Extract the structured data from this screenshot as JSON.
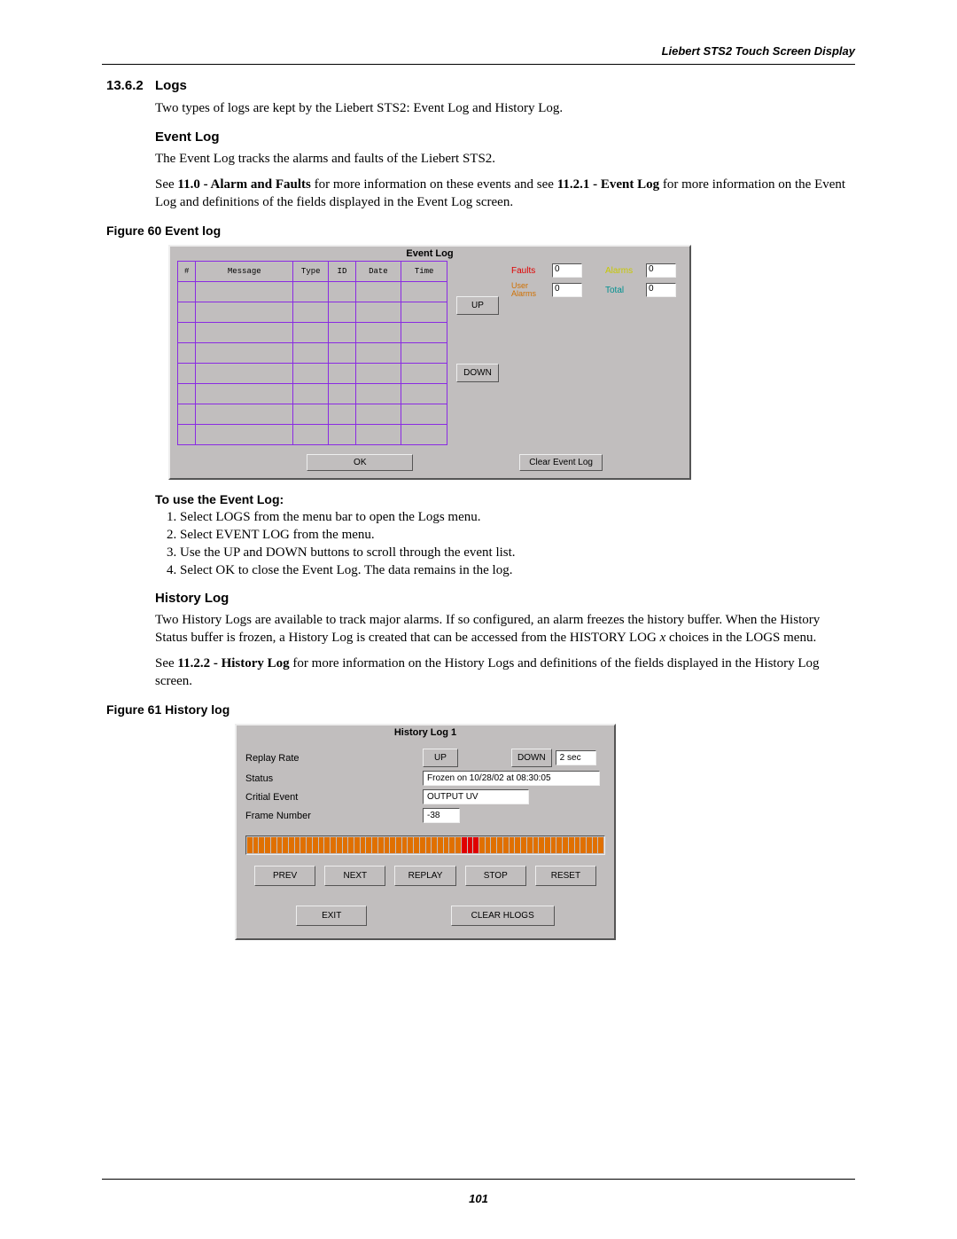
{
  "header": "Liebert STS2 Touch Screen Display",
  "sec_num": "13.6.2",
  "sec_title": "Logs",
  "intro": "Two types of logs are kept by the Liebert STS2: Event Log and History Log.",
  "eventlog_h": "Event Log",
  "eventlog_p1": "The Event Log tracks the alarms and faults of the Liebert STS2.",
  "eventlog_p2a": "See ",
  "eventlog_p2b": "11.0 - Alarm and Faults",
  "eventlog_p2c": " for more information on these events and see ",
  "eventlog_p2d": "11.2.1 - Event Log",
  "eventlog_p2e": " for more information on the Event Log and definitions of the fields displayed in the Event Log screen.",
  "fig60": "Figure 60   Event log",
  "el_win_title": "Event Log",
  "el_cols": {
    "num": "#",
    "msg": "Message",
    "type": "Type",
    "id": "ID",
    "date": "Date",
    "time": "Time"
  },
  "el_up": "UP",
  "el_down": "DOWN",
  "el_stats": {
    "faults_lbl": "Faults",
    "faults_val": "0",
    "user_lbl": "User Alarms",
    "user_val": "0",
    "alarms_lbl": "Alarms",
    "alarms_val": "0",
    "total_lbl": "Total",
    "total_val": "0"
  },
  "el_ok": "OK",
  "el_clear": "Clear Event Log",
  "use_el_h": "To use the Event Log:",
  "steps": [
    "Select LOGS from the menu bar to open the Logs menu.",
    "Select EVENT LOG from the menu.",
    "Use the UP and DOWN buttons to scroll through the event list.",
    "Select OK to close the Event Log. The data remains in the log."
  ],
  "historylog_h": "History Log",
  "hl_p1": "Two History Logs are available to track major alarms. If so configured, an alarm freezes the history buffer. When the History Status buffer is frozen, a History Log is created that can be accessed from the HISTORY LOG x choices in the LOGS menu.",
  "hl_p2a": "See ",
  "hl_p2b": "11.2.2 - History Log",
  "hl_p2c": " for more information on the History Logs and definitions of the fields displayed in the History Log screen.",
  "fig61": "Figure 61   History log",
  "hl_win_title": "History Log 1",
  "hl_rows": {
    "replay": "Replay Rate",
    "status": "Status",
    "critical": "Critial Event",
    "frame": "Frame Number"
  },
  "hl_vals": {
    "up": "UP",
    "down": "DOWN",
    "rate": "2 sec",
    "status": "Frozen on 10/28/02 at 08:30:05",
    "critical": "OUTPUT UV",
    "frame": "-38"
  },
  "hl_btns": {
    "prev": "PREV",
    "next": "NEXT",
    "replay": "REPLAY",
    "stop": "STOP",
    "reset": "RESET",
    "exit": "EXIT",
    "clear": "CLEAR HLOGS"
  },
  "page_num": "101"
}
